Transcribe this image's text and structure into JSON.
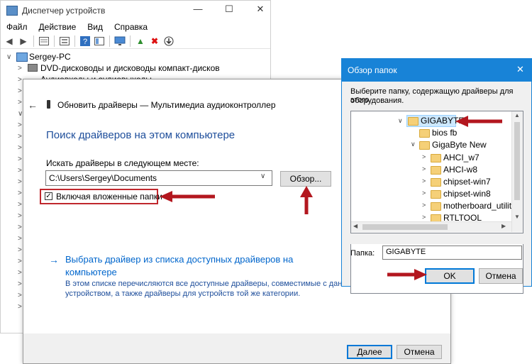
{
  "devmgr": {
    "title": "Диспетчер устройств",
    "menu": [
      "Файл",
      "Действие",
      "Вид",
      "Справка"
    ],
    "tree": {
      "root": "Sergey-PC",
      "items": [
        "DVD-дисководы и дисководы компакт-дисков",
        "Аудиовходы и аудиовыходы"
      ]
    }
  },
  "update_dialog": {
    "header": "Обновить драйверы — Мультимедиа аудиоконтроллер",
    "heading": "Поиск драйверов на этом компьютере",
    "search_label": "Искать драйверы в следующем месте:",
    "path_value": "C:\\Users\\Sergey\\Documents",
    "browse_button": "Обзор...",
    "include_subfolders": "Включая вложенные папки",
    "include_subfolders_checked": true,
    "pick_link_line1": "Выбрать драйвер из списка доступных драйверов на",
    "pick_link_line2": "компьютере",
    "pick_desc_line1": "В этом списке перечисляются все доступные драйверы, совместимые с данным",
    "pick_desc_line2": "устройством, а также драйверы для устройств той же категории.",
    "next_button": "Далее",
    "cancel_button": "Отмена"
  },
  "browse_dialog": {
    "title": "Обзор папок",
    "instruction_line1": "Выберите папку, содержащую драйверы для этого",
    "instruction_line2": "оборудования.",
    "folders": [
      "GIGABYTE",
      "bios fb",
      "GigaByte New",
      "AHCI_w7",
      "AHCI-w8",
      "chipset-win7",
      "chipset-win8",
      "motherboard_utility_x",
      "RTLTOOL"
    ],
    "selected_folder": "GIGABYTE",
    "folder_label": "Папка:",
    "folder_value": "GIGABYTE",
    "ok_button": "OK",
    "cancel_button": "Отмена"
  },
  "colors": {
    "accent": "#0078d7",
    "link": "#0066cc",
    "highlight_border": "#c0272d",
    "arrow": "#b3171f"
  }
}
